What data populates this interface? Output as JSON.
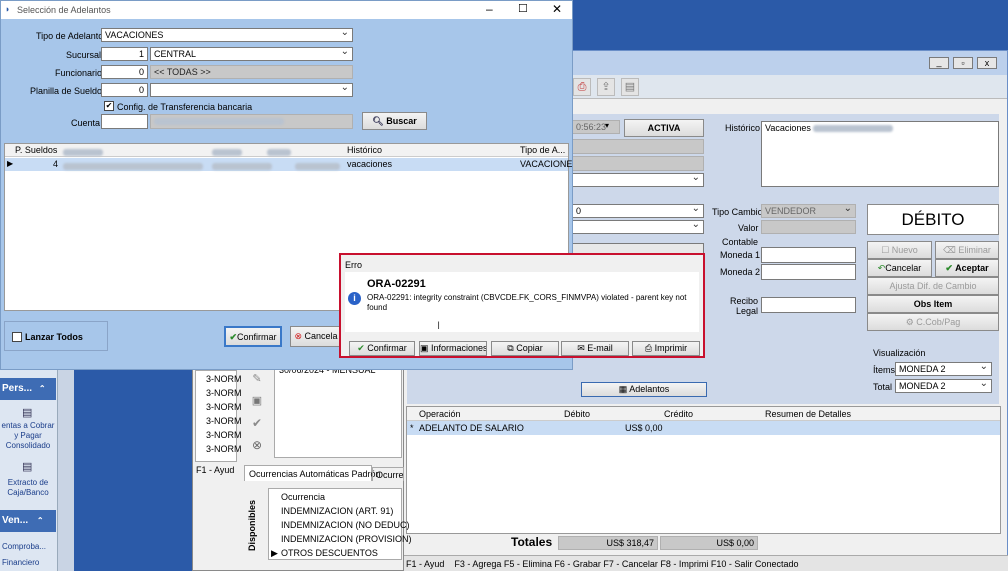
{
  "dialog": {
    "title": "Selección de Adelantos",
    "tipo_label": "Tipo de Adelanto",
    "tipo_value": "VACACIONES",
    "sucursal_label": "Sucursal",
    "sucursal_code": "1",
    "sucursal_name": "CENTRAL",
    "funcionario_label": "Funcionario",
    "funcionario_code": "0",
    "funcionario_name": "<< TODAS >>",
    "planilla_label": "Planilla de Sueldos",
    "planilla_code": "0",
    "config_checkbox": "Config. de Transferencia bancaria",
    "cuenta_label": "Cuenta",
    "buscar": "Buscar",
    "grid_headers": [
      "P. Sueldos",
      "Histórico",
      "Tipo de A..."
    ],
    "grid_row": {
      "p_sueldos": "4",
      "historico": "vacaciones",
      "tipo": "VACACIONE"
    },
    "lanzar": "Lanzar Todos",
    "confirmar": "Confirmar",
    "cancelar": "Cancela"
  },
  "error": {
    "header": "Erro",
    "code": "ORA-02291",
    "message": "ORA-02291: integrity constraint (CBVCDE.FK_CORS_FINMVPA) violated - parent key not found",
    "btn_confirmar": "Confirmar",
    "btn_informaciones": "Informaciones",
    "btn_copiar": "Copiar",
    "btn_email": "E-mail",
    "btn_imprimir": "Imprimir"
  },
  "main": {
    "time": "0:56:23",
    "status": "ACTIVA",
    "historico_label": "Histórico",
    "historico_value": "Vacaciones",
    "combo_value": "0",
    "tipo_cambio_label": "Tipo Cambio",
    "tipo_cambio_value": "VENDEDOR",
    "valor_label": "Valor",
    "contable_label": "Contable",
    "moneda1_label": "Moneda 1",
    "moneda2_label": "Moneda 2",
    "recibo_label": "Recibo Legal",
    "debito_title": "DÉBITO",
    "nuevo": "Nuevo",
    "eliminar": "Eliminar",
    "cancelar": "Cancelar",
    "aceptar": "Aceptar",
    "ajusta": "Ajusta Dif. de Cambio",
    "obs_item": "Obs Item",
    "ccob": "C.Cob/Pag",
    "adelantos": "Adelantos",
    "visualizacion": "Visualización",
    "items_label": "Ítems",
    "items_value": "MONEDA 2",
    "total_label": "Total",
    "total_value": "MONEDA 2",
    "grid_headers": [
      "Operación",
      "Débito",
      "Crédito",
      "Resumen de Detalles"
    ],
    "grid_row": {
      "marker": "*",
      "operacion": "ADELANTO DE SALARIO",
      "debito": "US$ 0,00"
    },
    "totales_label": "Totales",
    "totales_debito": "US$ 318,47",
    "totales_credito": "US$ 0,00",
    "status_bar": "F1 - Ayud    F3 - Agrega F5 - Elimina F6 - Grabar F7 - Cancelar F8 - Imprimi F10 - Salir Conectado"
  },
  "mid": {
    "list_items": [
      "3-NORM",
      "3-NORM",
      "3-NORM",
      "3-NORM",
      "3-NORM",
      "3-NORM"
    ],
    "f1": "F1 - Ayud",
    "date_row": "30/06/2024 - MENSUAL",
    "tab1": "Ocurrencias Automáticas Padrón",
    "tab2": "Ocurre",
    "disponibles": "Disponibles",
    "ocurrencia_header": "Ocurrencia",
    "ocurrencias": [
      "INDEMNIZACION (ART. 91)",
      "INDEMNIZACION (NO DEDUC)",
      "INDEMNIZACION (PROVISION)",
      "OTROS DESCUENTOS"
    ]
  },
  "left": {
    "pers": "Pers...",
    "item1": "entas a Cobrar y Pagar Consolidado",
    "item2": "Extracto de Caja/Banco",
    "ven": "Ven...",
    "item3": "Comproba...",
    "item4": "Financiero"
  }
}
